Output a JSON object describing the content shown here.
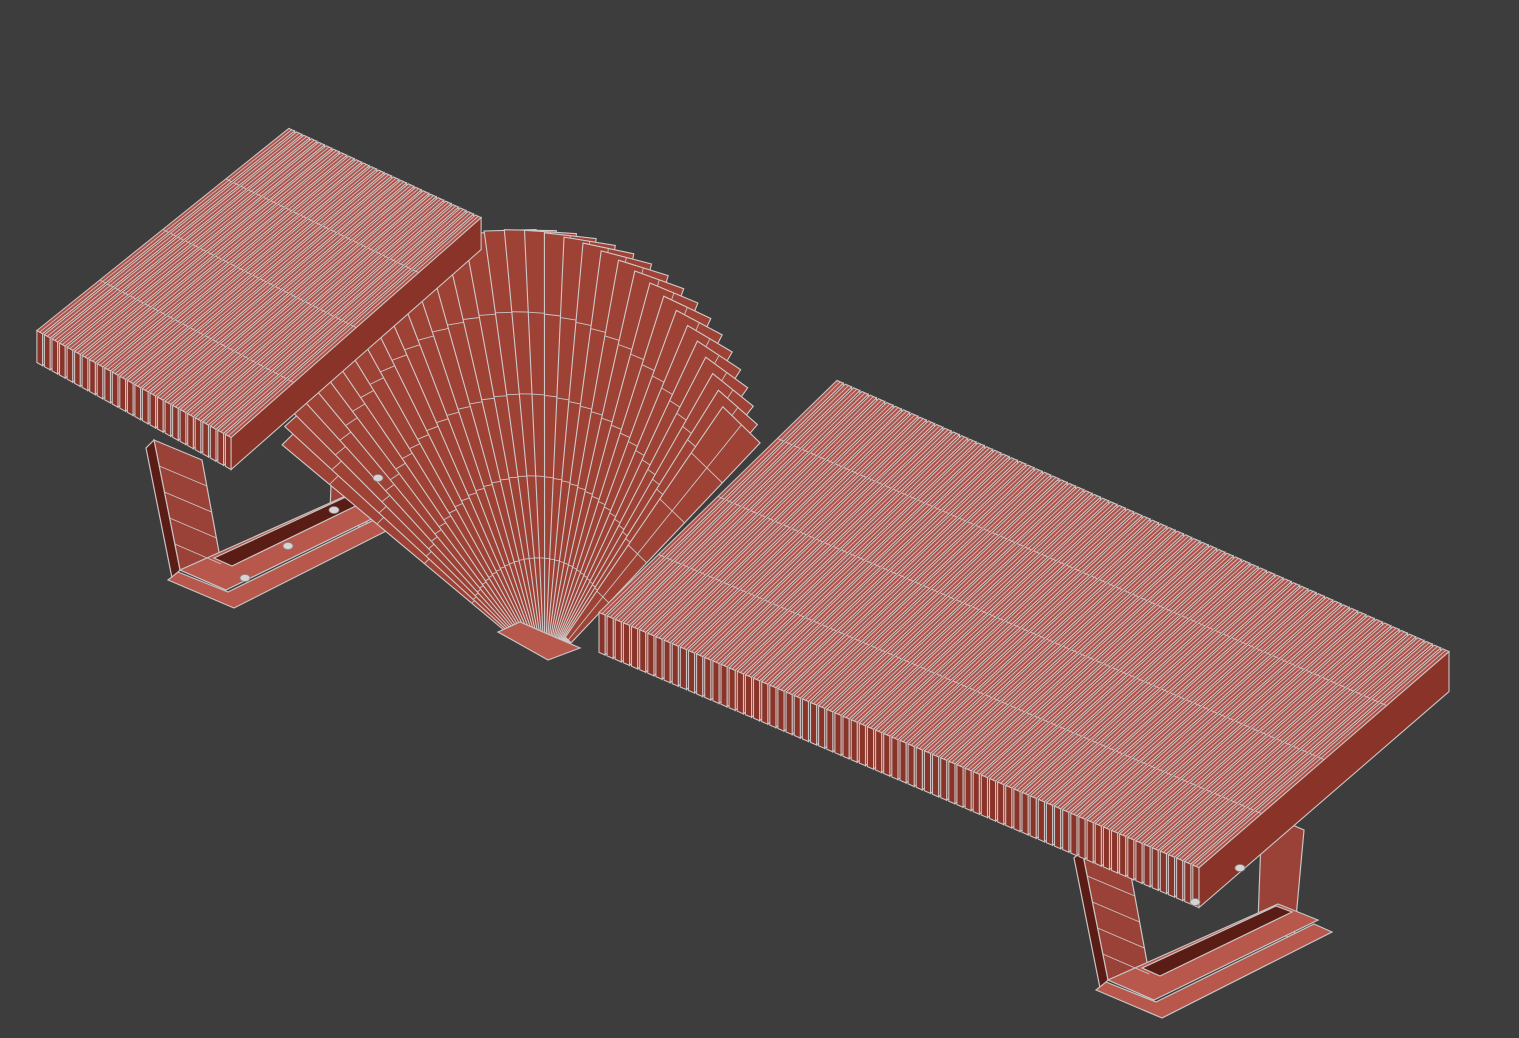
{
  "viewport": {
    "background": "#3d3d3d",
    "display_mode": "wireframe-over-shaded"
  },
  "model": {
    "object": "bench",
    "colors": {
      "slat_top": "#b0524a",
      "slat_side": "#8a3328",
      "wire": "#c9c4c4",
      "leg_dark": "#5a1d15"
    }
  }
}
